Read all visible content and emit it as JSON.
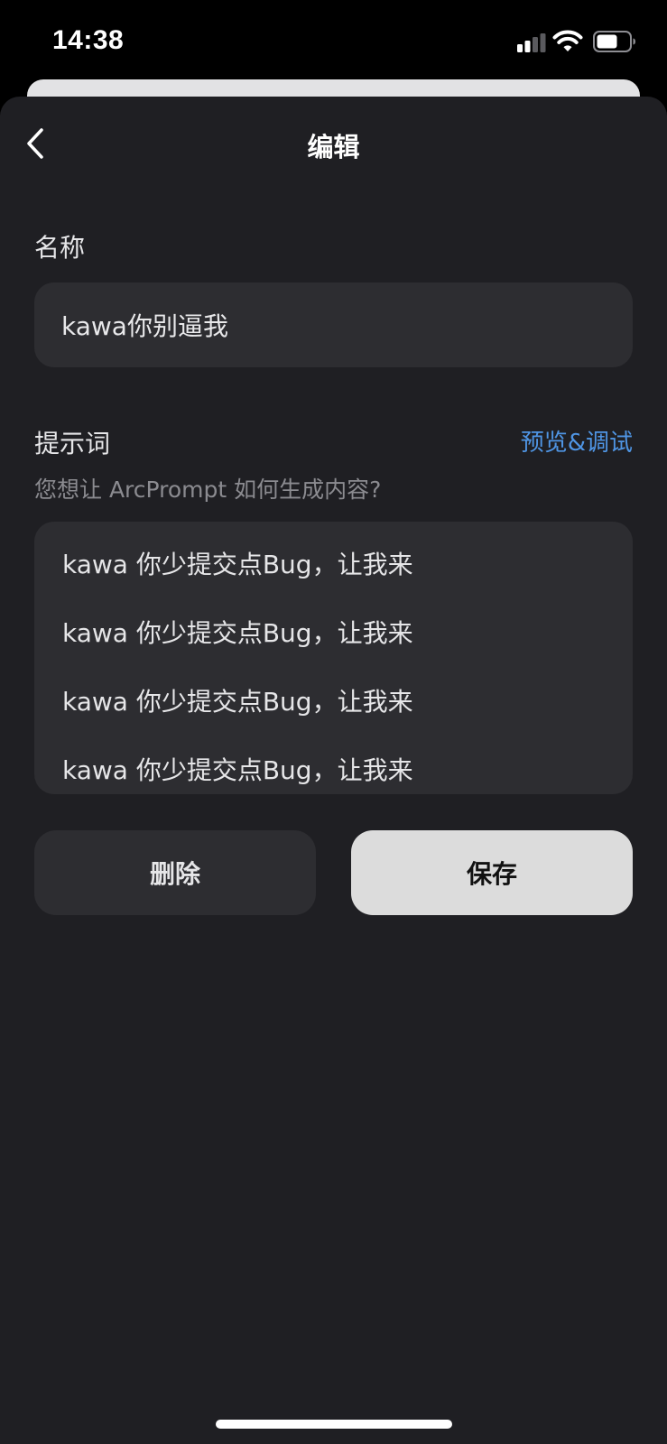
{
  "status_bar": {
    "time": "14:38"
  },
  "header": {
    "title": "编辑",
    "back_icon": "chevron-left-icon"
  },
  "name_field": {
    "label": "名称",
    "value": "kawa你别逼我"
  },
  "prompt_field": {
    "label": "提示词",
    "preview_link": "预览&调试",
    "hint": "您想让 ArcPrompt 如何生成内容?",
    "lines": [
      "kawa 你少提交点Bug，让我来",
      "kawa 你少提交点Bug，让我来",
      "kawa 你少提交点Bug，让我来",
      "kawa 你少提交点Bug，让我来"
    ]
  },
  "actions": {
    "delete_label": "删除",
    "save_label": "保存"
  },
  "colors": {
    "sheet_background": "#1f1f23",
    "field_background": "#2d2d31",
    "accent_link": "#4f95e4",
    "save_button": "#dcdcdc"
  }
}
